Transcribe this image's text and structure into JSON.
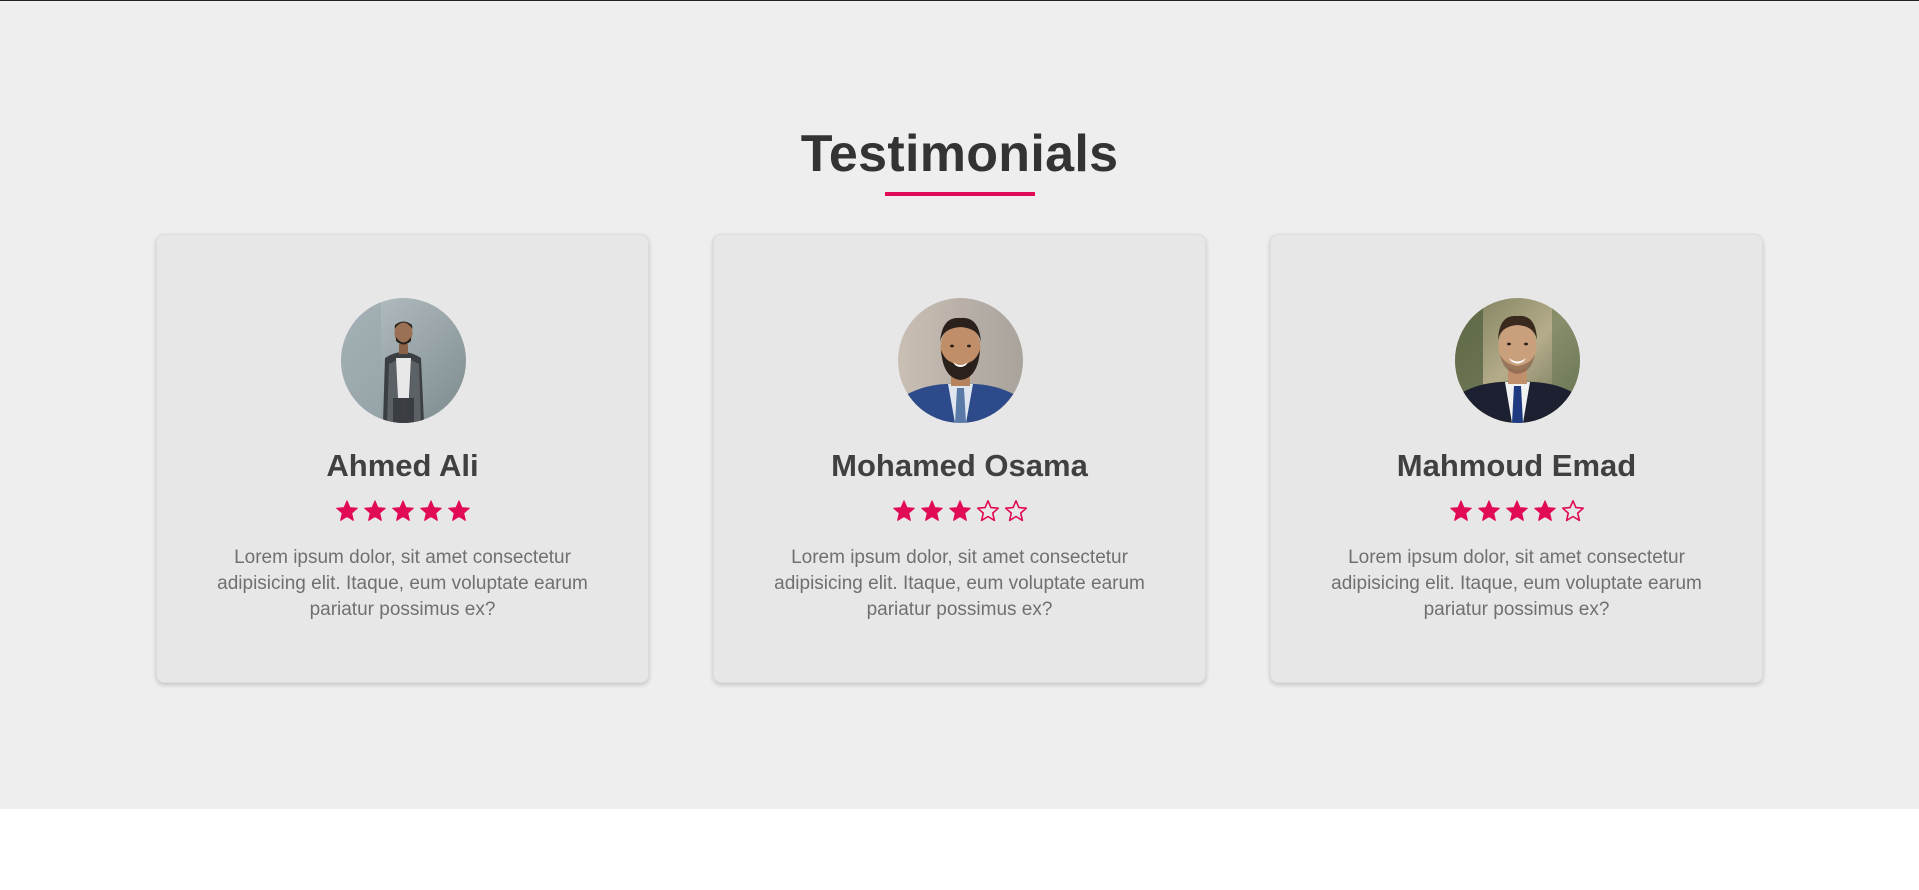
{
  "section": {
    "title": "Testimonials"
  },
  "colors": {
    "accent": "#e10a57",
    "section_background": "#eeeeee",
    "card_background": "#e7e7e7",
    "heading_text": "#333333",
    "name_text": "#404040",
    "body_text": "#707070"
  },
  "testimonials": [
    {
      "name": "Ahmed Ali",
      "rating": 5,
      "max_rating": 5,
      "text": "Lorem ipsum dolor, sit amet consectetur adipisicing elit. Itaque, eum voluptate earum pariatur possimus ex?",
      "avatar_icon": "person-photo-avatar"
    },
    {
      "name": "Mohamed Osama",
      "rating": 3,
      "max_rating": 5,
      "text": "Lorem ipsum dolor, sit amet consectetur adipisicing elit. Itaque, eum voluptate earum pariatur possimus ex?",
      "avatar_icon": "person-photo-avatar"
    },
    {
      "name": "Mahmoud Emad",
      "rating": 4,
      "max_rating": 5,
      "text": "Lorem ipsum dolor, sit amet consectetur adipisicing elit. Itaque, eum voluptate earum pariatur possimus ex?",
      "avatar_icon": "person-photo-avatar"
    }
  ]
}
